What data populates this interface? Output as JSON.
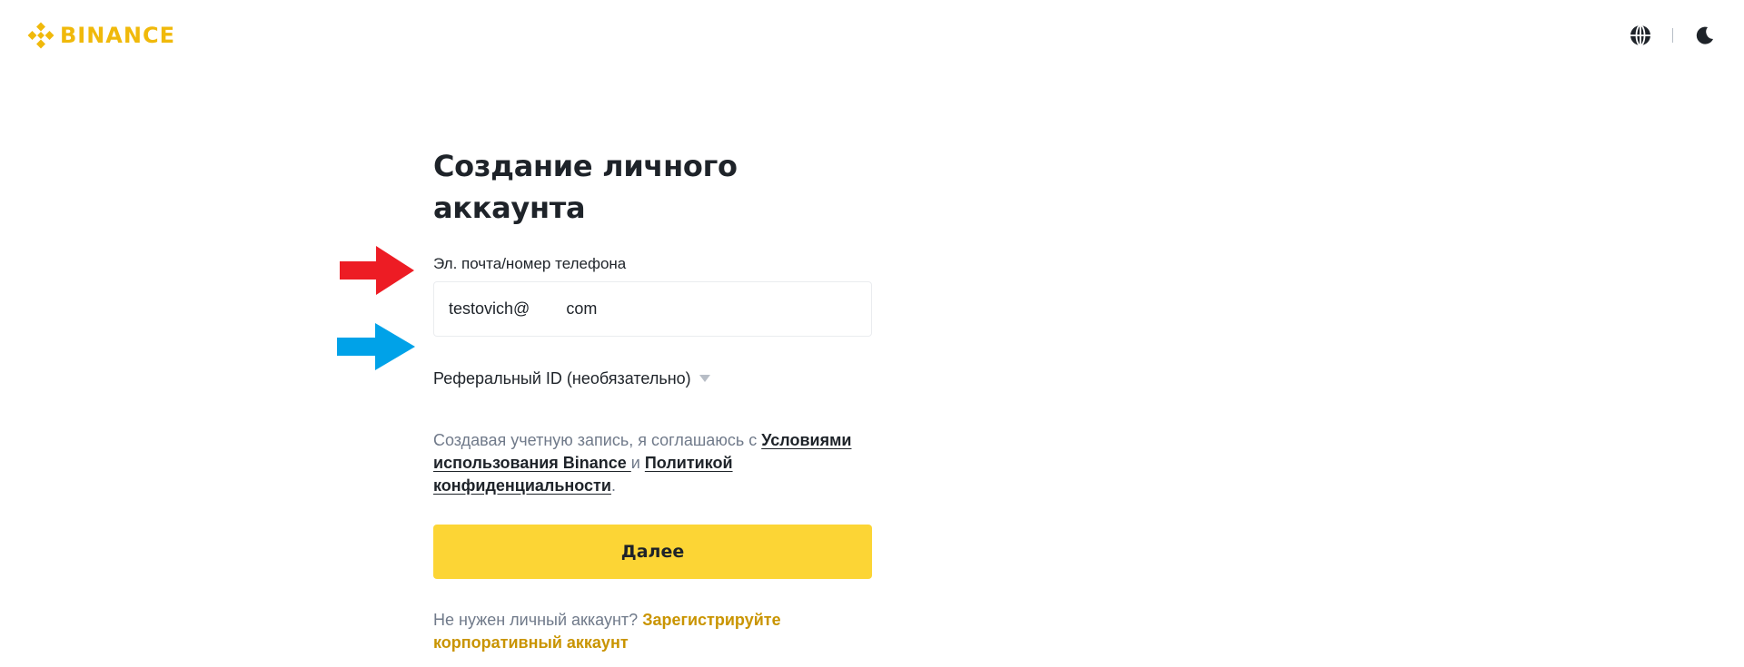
{
  "header": {
    "brand": "BINANCE",
    "brand_color": "#f0b90b",
    "icons": [
      "binance-logo-icon",
      "globe-icon",
      "moon-icon"
    ]
  },
  "form": {
    "title": "Создание личного аккаунта",
    "email_label": "Эл. почта/номер телефона",
    "email_value": "testovich@        com",
    "referral_label": "Реферальный ID (необязательно)",
    "terms_prefix": "Создавая учетную запись, я соглашаюсь с ",
    "terms_link_1": "Условиями использования Binance ",
    "terms_middle": "и ",
    "terms_link_2": "Политикой конфиденциальности",
    "terms_suffix": ".",
    "next_label": "Далее",
    "business_prefix": "Не нужен личный аккаунт? ",
    "business_link": "Зарегистрируйте корпоративный аккаунт"
  },
  "colors": {
    "primary_button": "#fcd535",
    "link_accent": "#c99400",
    "annotation_red": "#ed1c24",
    "annotation_blue": "#00a2e8"
  }
}
